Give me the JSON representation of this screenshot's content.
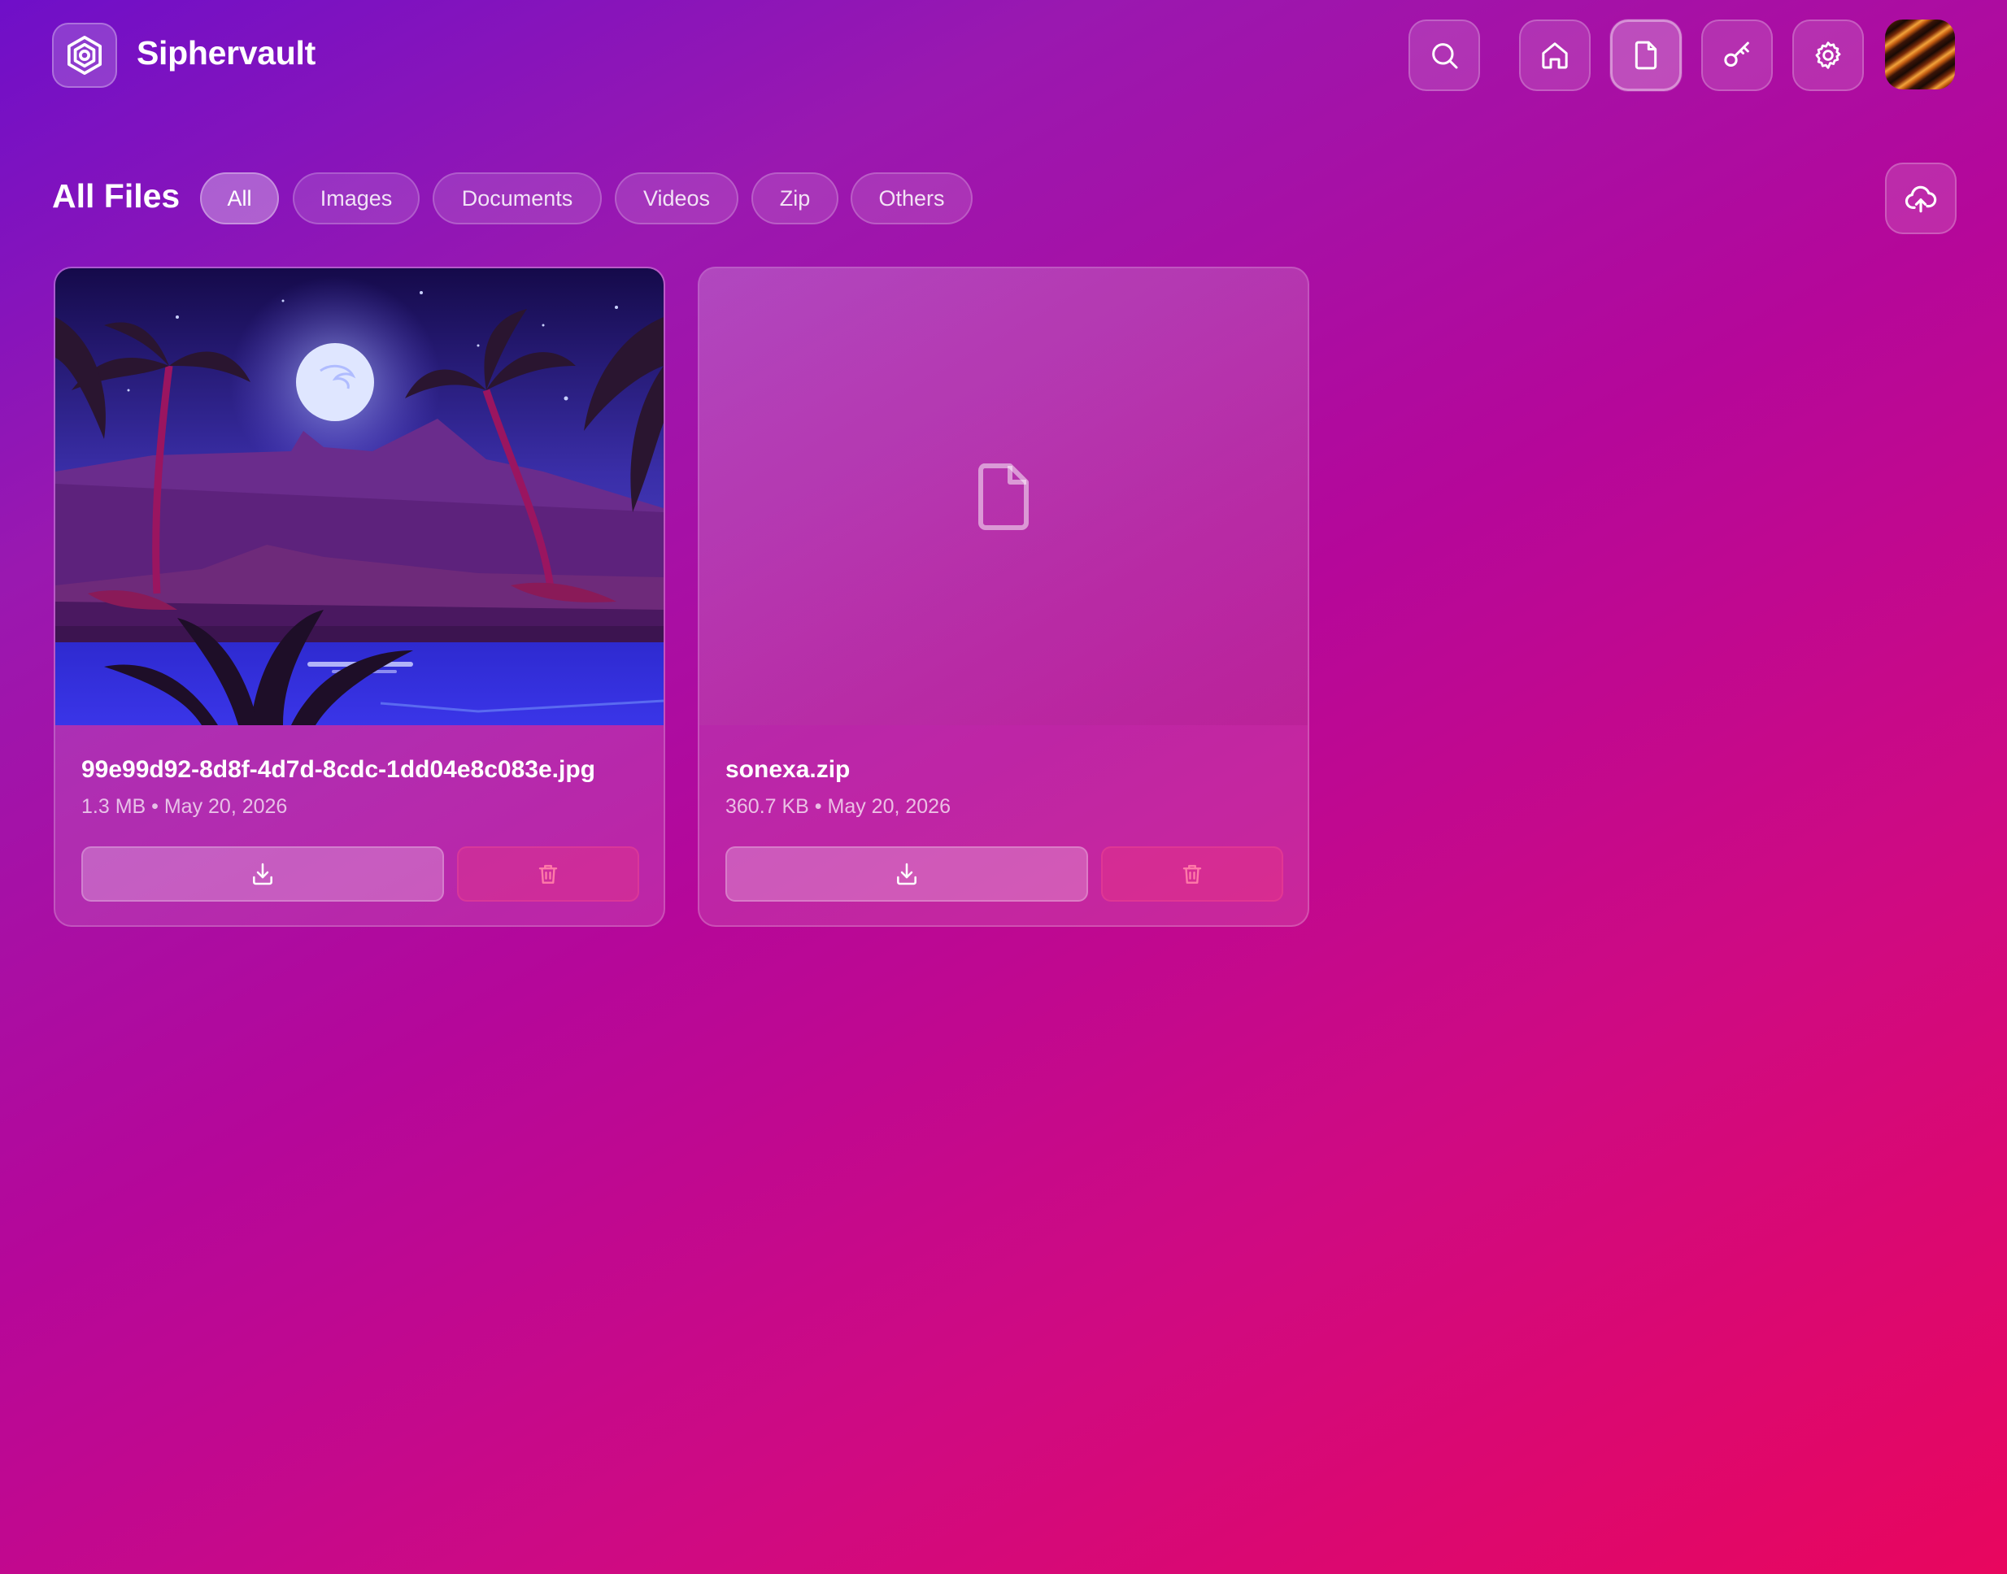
{
  "app": {
    "title": "Siphervault"
  },
  "header": {
    "nav": [
      {
        "icon": "search-icon"
      },
      {
        "icon": "home-icon"
      },
      {
        "icon": "file-icon",
        "active": true
      },
      {
        "icon": "key-icon"
      },
      {
        "icon": "gear-icon"
      }
    ]
  },
  "page": {
    "title": "All Files",
    "filters": [
      {
        "label": "All",
        "active": true
      },
      {
        "label": "Images"
      },
      {
        "label": "Documents"
      },
      {
        "label": "Videos"
      },
      {
        "label": "Zip"
      },
      {
        "label": "Others"
      }
    ]
  },
  "files": [
    {
      "name": "99e99d92-8d8f-4d7d-8cdc-1dd04e8c083e.jpg",
      "meta": "1.3 MB • May 20, 2026",
      "thumbnail": "image"
    },
    {
      "name": "sonexa.zip",
      "meta": "360.7 KB • May 20, 2026",
      "thumbnail": "file-icon"
    }
  ],
  "colors": {
    "bg_start": "#6f0fc8",
    "bg_mid": "#b5079a",
    "bg_end": "#e8065e"
  }
}
